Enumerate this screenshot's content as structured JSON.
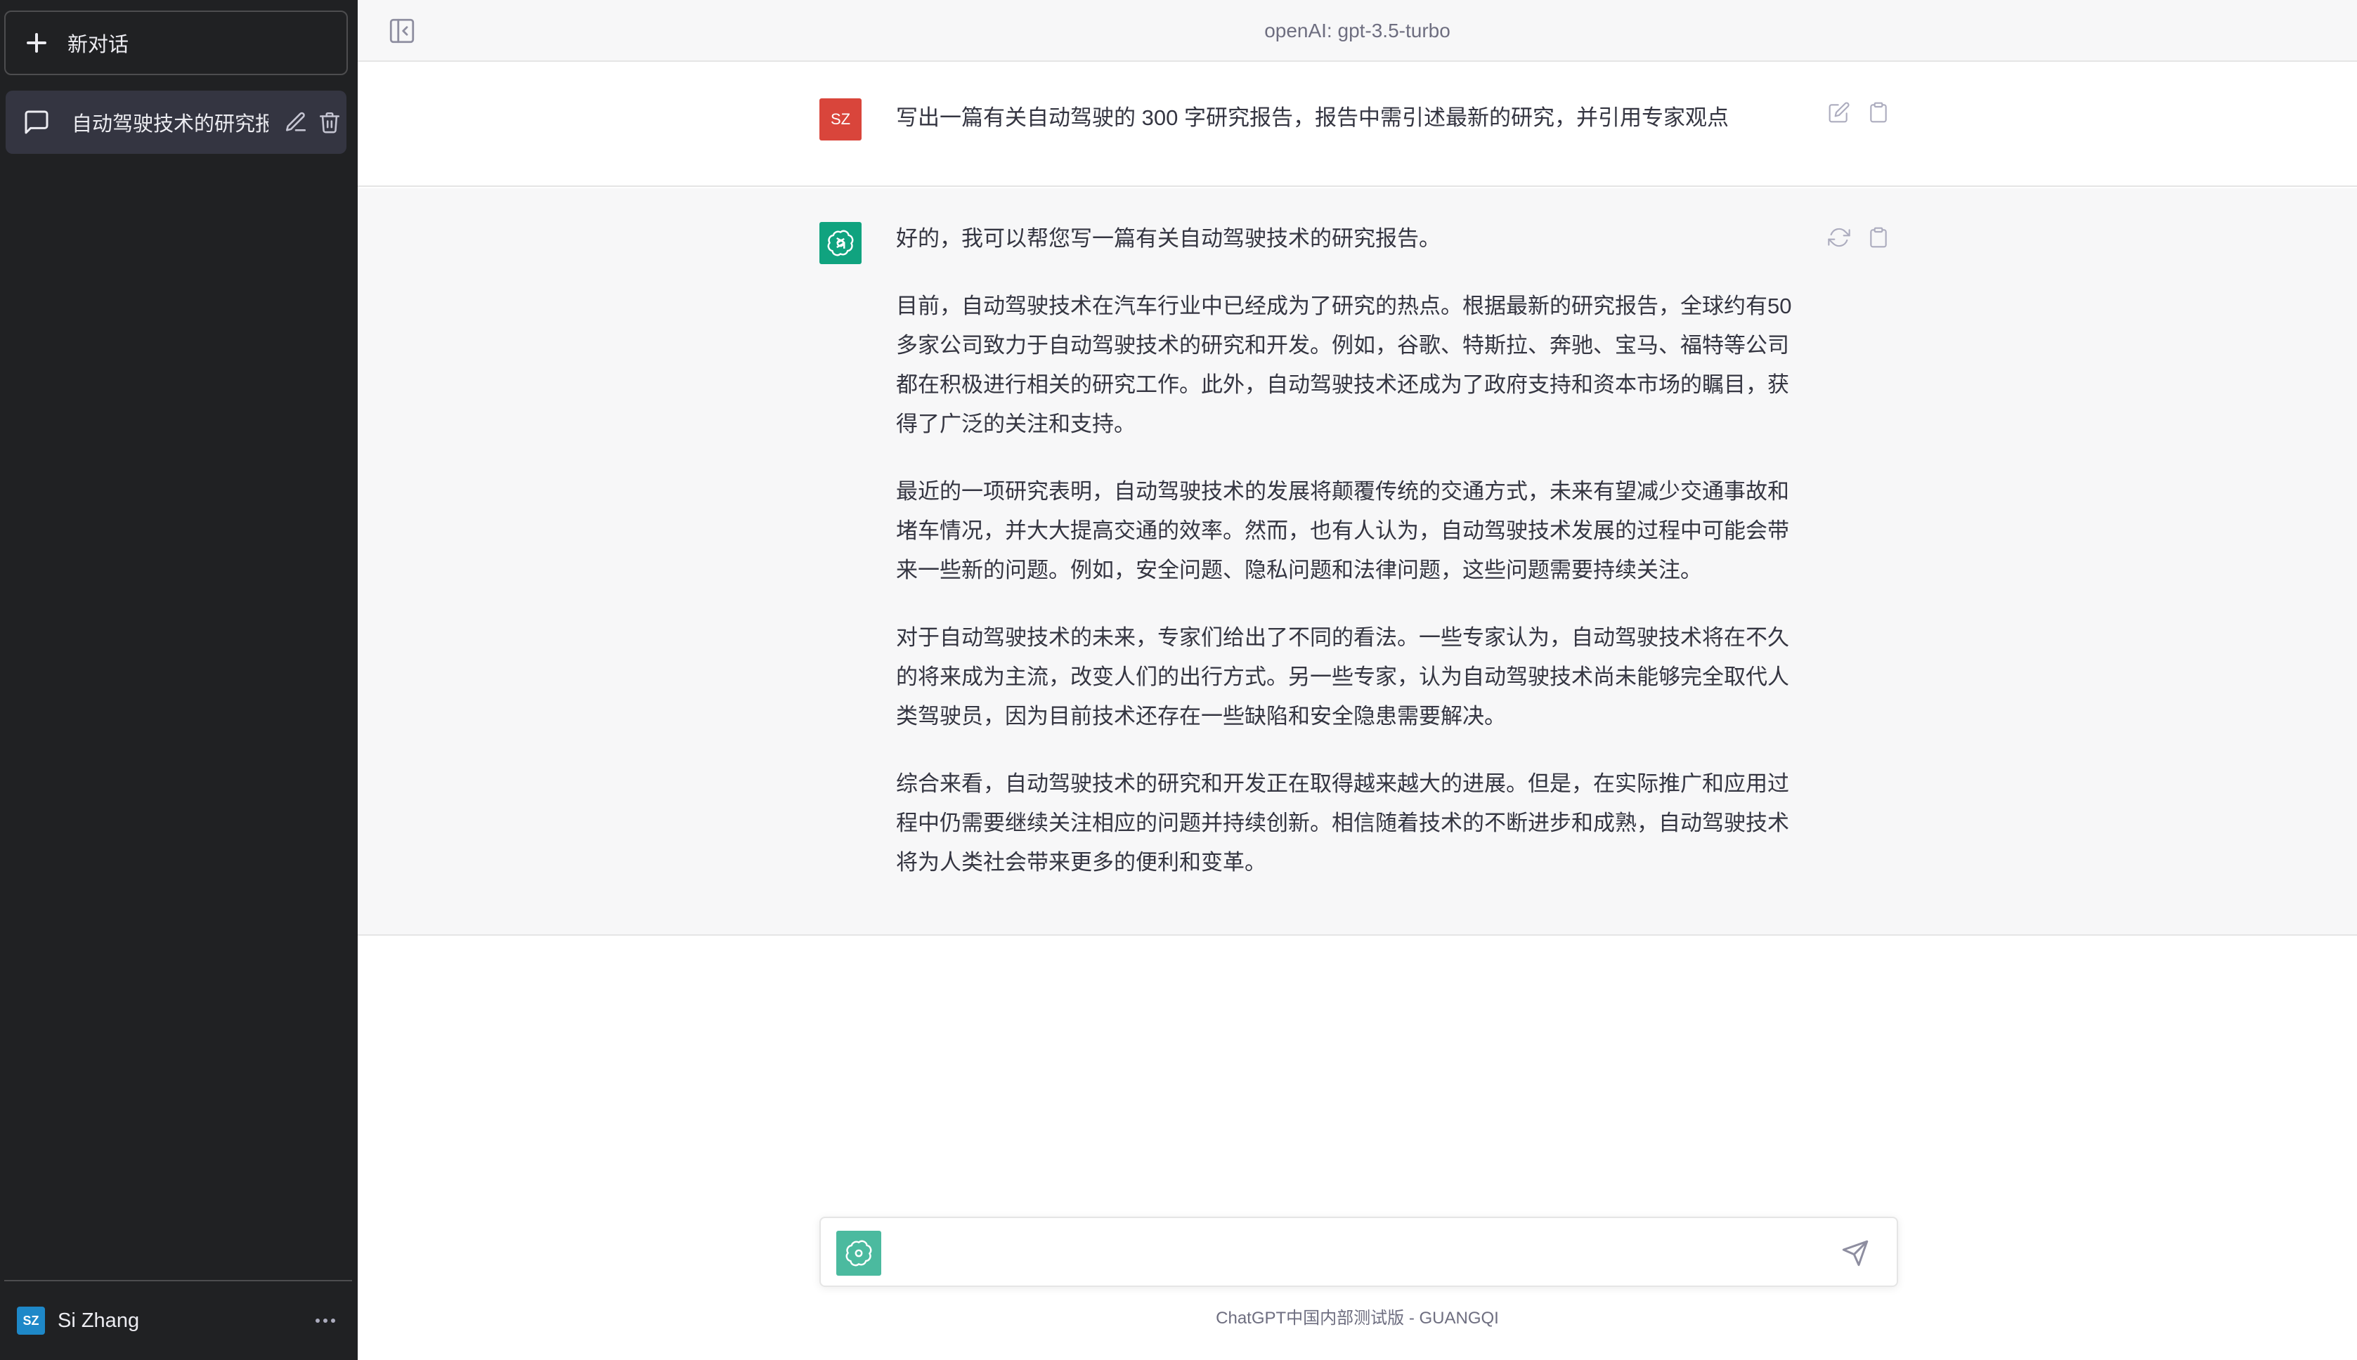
{
  "sidebar": {
    "new_chat_label": "新对话",
    "conversations": [
      {
        "title": "自动驾驶技术的研究报"
      }
    ],
    "user": {
      "initials": "SZ",
      "name": "Si Zhang"
    }
  },
  "header": {
    "model_title": "openAI: gpt-3.5-turbo"
  },
  "messages": {
    "user": {
      "avatar_initials": "SZ",
      "text": "写出一篇有关自动驾驶的 300 字研究报告，报告中需引述最新的研究，并引用专家观点"
    },
    "assistant": {
      "paragraphs": [
        "好的，我可以帮您写一篇有关自动驾驶技术的研究报告。",
        "目前，自动驾驶技术在汽车行业中已经成为了研究的热点。根据最新的研究报告，全球约有50多家公司致力于自动驾驶技术的研究和开发。例如，谷歌、特斯拉、奔驰、宝马、福特等公司都在积极进行相关的研究工作。此外，自动驾驶技术还成为了政府支持和资本市场的瞩目，获得了广泛的关注和支持。",
        "最近的一项研究表明，自动驾驶技术的发展将颠覆传统的交通方式，未来有望减少交通事故和堵车情况，并大大提高交通的效率。然而，也有人认为，自动驾驶技术发展的过程中可能会带来一些新的问题。例如，安全问题、隐私问题和法律问题，这些问题需要持续关注。",
        "对于自动驾驶技术的未来，专家们给出了不同的看法。一些专家认为，自动驾驶技术将在不久的将来成为主流，改变人们的出行方式。另一些专家，认为自动驾驶技术尚未能够完全取代人类驾驶员，因为目前技术还存在一些缺陷和安全隐患需要解决。",
        "综合来看，自动驾驶技术的研究和开发正在取得越来越大的进展。但是，在实际推广和应用过程中仍需要继续关注相应的问题并持续创新。相信随着技术的不断进步和成熟，自动驾驶技术将为人类社会带来更多的便利和变革。"
      ]
    }
  },
  "input": {
    "value": "",
    "placeholder": ""
  },
  "footer": {
    "note": "ChatGPT中国内部测试版 - GUANGQI"
  },
  "colors": {
    "sidebar_bg": "#202123",
    "active_conversation_bg": "#343541",
    "user_avatar_bg": "#d9453b",
    "assistant_avatar_bg": "#10a37f",
    "sidebar_user_avatar_bg": "#1e88c8"
  },
  "icons": {
    "new_chat": "plus-icon",
    "conversation": "chat-bubble-icon",
    "edit": "pencil-icon",
    "delete": "trash-icon",
    "sidebar_toggle": "sidebar-toggle-icon",
    "user_msg_edit": "edit-icon",
    "copy": "clipboard-icon",
    "regenerate": "refresh-icon",
    "send": "send-icon",
    "assistant_logo": "openai-logo-icon",
    "more": "ellipsis-icon"
  }
}
